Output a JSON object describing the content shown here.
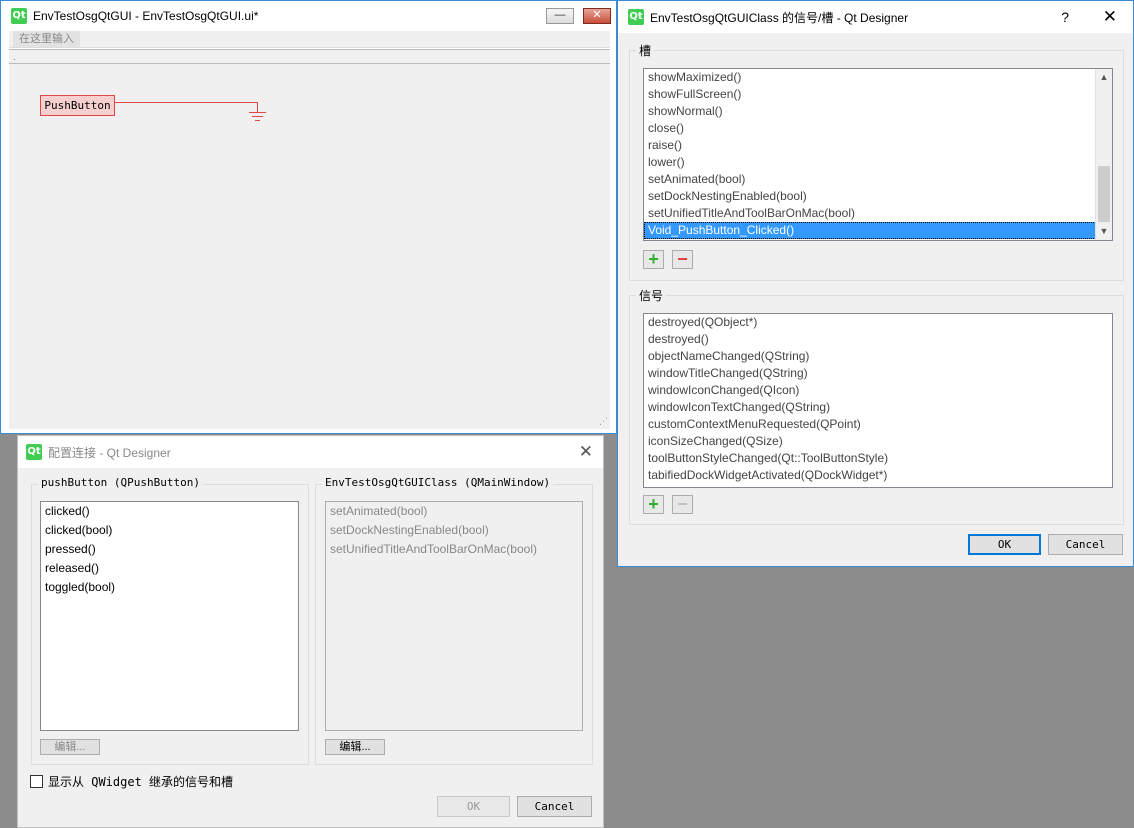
{
  "main_window": {
    "title": "EnvTestOsgQtGUI - EnvTestOsgQtGUI.ui*",
    "logo": "Qt",
    "menubar_placeholder": "在这里输入",
    "form_dot": ".",
    "pushbutton_text": "PushButton",
    "minimize_glyph": "—",
    "close_glyph": "✕"
  },
  "slots_dialog": {
    "title": "EnvTestOsgQtGUIClass 的信号/槽 - Qt Designer",
    "logo": "Qt",
    "help_glyph": "?",
    "close_glyph": "✕",
    "slots_group_title": "槽",
    "slots": [
      "showMaximized()",
      "showFullScreen()",
      "showNormal()",
      "close()",
      "raise()",
      "lower()",
      "setAnimated(bool)",
      "setDockNestingEnabled(bool)",
      "setUnifiedTitleAndToolBarOnMac(bool)",
      "Void_PushButton_Clicked()"
    ],
    "selected_slot_index": 9,
    "signals_group_title": "信号",
    "signals": [
      "destroyed(QObject*)",
      "destroyed()",
      "objectNameChanged(QString)",
      "windowTitleChanged(QString)",
      "windowIconChanged(QIcon)",
      "windowIconTextChanged(QString)",
      "customContextMenuRequested(QPoint)",
      "iconSizeChanged(QSize)",
      "toolButtonStyleChanged(Qt::ToolButtonStyle)",
      "tabifiedDockWidgetActivated(QDockWidget*)"
    ],
    "add_glyph": "+",
    "remove_glyph": "−",
    "ok_label": "OK",
    "cancel_label": "Cancel",
    "scroll_up_glyph": "▲",
    "scroll_down_glyph": "▼"
  },
  "connection_dialog": {
    "title": "配置连接 - Qt Designer",
    "logo": "Qt",
    "close_glyph": "✕",
    "sender_group_title": "pushButton (QPushButton)",
    "sender_signals": [
      "clicked()",
      "clicked(bool)",
      "pressed()",
      "released()",
      "toggled(bool)"
    ],
    "receiver_group_title": "EnvTestOsgQtGUIClass (QMainWindow)",
    "receiver_slots": [
      "setAnimated(bool)",
      "setDockNestingEnabled(bool)",
      "setUnifiedTitleAndToolBarOnMac(bool)"
    ],
    "edit_label_left": "编辑...",
    "edit_label_right": "编辑...",
    "inherit_checkbox_label": "显示从 QWidget 继承的信号和槽",
    "ok_label": "OK",
    "cancel_label": "Cancel"
  }
}
